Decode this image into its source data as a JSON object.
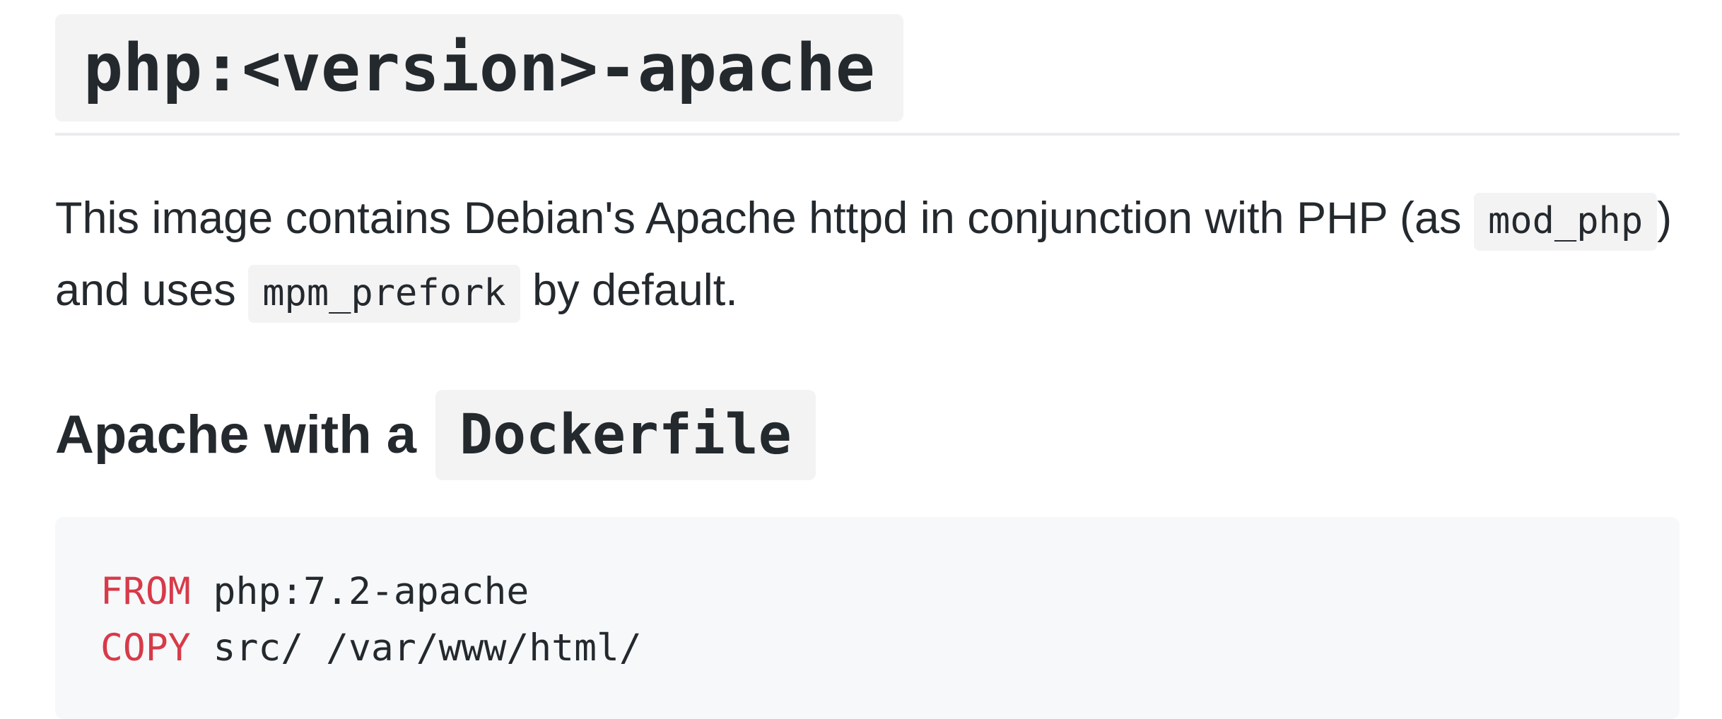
{
  "heading": {
    "code": "php:<version>-apache"
  },
  "description": {
    "text_before": "This image contains Debian's Apache httpd in conjunction with PHP (as ",
    "code1": "mod_php",
    "text_middle": ") and uses ",
    "code2": "mpm_prefork",
    "text_after": " by default."
  },
  "subheading": {
    "text": "Apache with a ",
    "code": "Dockerfile"
  },
  "code_block": {
    "lines": [
      {
        "keyword": "FROM",
        "rest": " php:7.2-apache"
      },
      {
        "keyword": "COPY",
        "rest": " src/ /var/www/html/"
      }
    ]
  },
  "colors": {
    "keyword": "#d73a49",
    "text": "#24292e",
    "code_bg": "#f6f8fa",
    "inline_code_bg": "#f3f3f3"
  }
}
